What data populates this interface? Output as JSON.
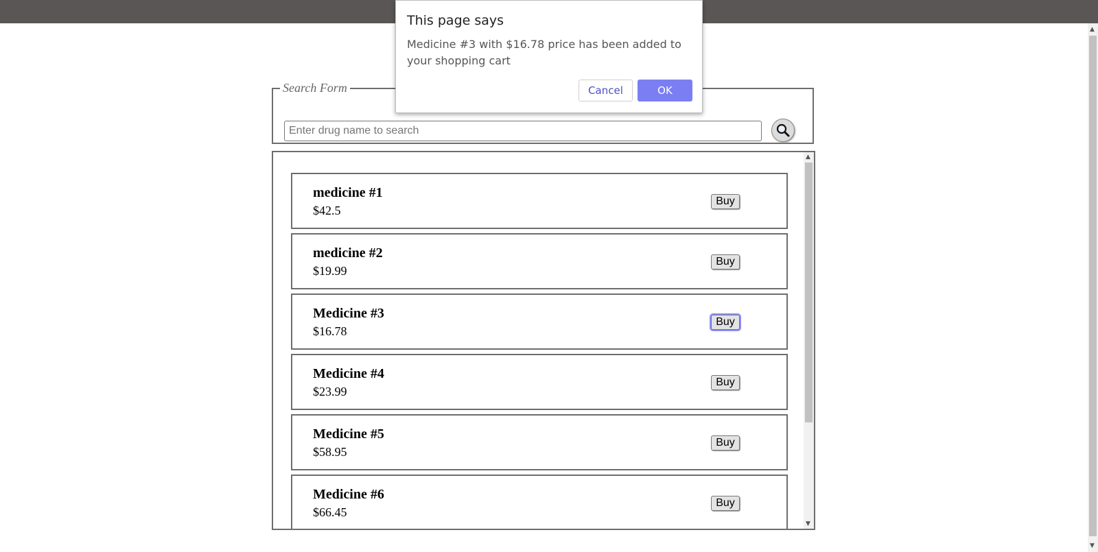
{
  "search": {
    "legend": "Search Form",
    "placeholder": "Enter drug name to search",
    "button_icon": "magnifier-icon"
  },
  "products": [
    {
      "name": "medicine #1",
      "price": "$42.5",
      "buy_label": "Buy"
    },
    {
      "name": "medicine #2",
      "price": "$19.99",
      "buy_label": "Buy"
    },
    {
      "name": "Medicine #3",
      "price": "$16.78",
      "buy_label": "Buy"
    },
    {
      "name": "Medicine #4",
      "price": "$23.99",
      "buy_label": "Buy"
    },
    {
      "name": "Medicine #5",
      "price": "$58.95",
      "buy_label": "Buy"
    },
    {
      "name": "Medicine #6",
      "price": "$66.45",
      "buy_label": "Buy"
    }
  ],
  "dialog": {
    "title": "This page says",
    "message": "Medicine #3 with $16.78 price has been added to your shopping cart",
    "cancel_label": "Cancel",
    "ok_label": "OK"
  },
  "colors": {
    "topbar": "#5a5655",
    "ok_button": "#7b7ef2",
    "cancel_text": "#4b4fc8",
    "focus_ring": "#8c8ff5"
  }
}
